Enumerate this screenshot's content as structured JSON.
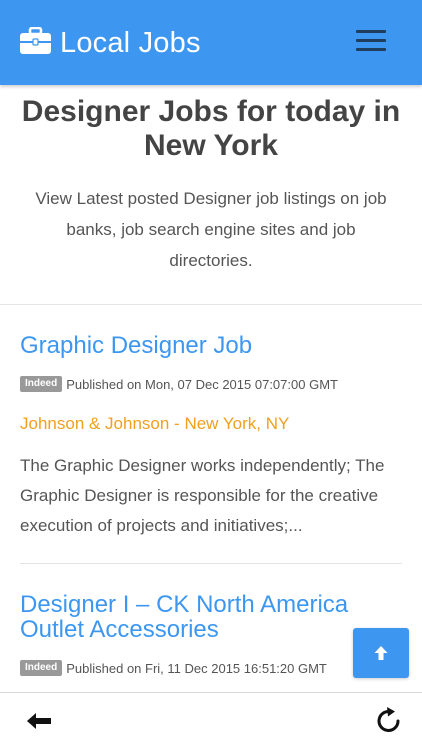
{
  "app_bar": {
    "title": "Local Jobs",
    "brand_icon": "briefcase-icon",
    "menu_icon": "hamburger-menu-icon",
    "color": "#3d97f0"
  },
  "page": {
    "heading": "Designer Jobs for today in New York",
    "subheading": "View Latest posted Designer job listings on job banks, job search engine sites and job directories."
  },
  "jobs": [
    {
      "title": "Graphic Designer Job",
      "source_badge": "Indeed",
      "published": "Published on Mon, 07 Dec 2015 07:07:00 GMT",
      "company": "Johnson & Johnson - New York, NY",
      "description": "The Graphic Designer works independently; The Graphic Designer is responsible for the creative execution of projects and initiatives;..."
    },
    {
      "title": "Designer I – CK North America Outlet Accessories",
      "source_badge": "Indeed",
      "published": "Published on Fri, 11 Dec 2015 16:51:20 GMT"
    }
  ],
  "controls": {
    "scroll_top_icon": "arrow-up-icon",
    "back_icon": "back-arrow-icon",
    "reload_icon": "reload-icon"
  },
  "colors": {
    "accent": "#3d97f0",
    "company": "#f0a020",
    "badge": "#999999"
  }
}
